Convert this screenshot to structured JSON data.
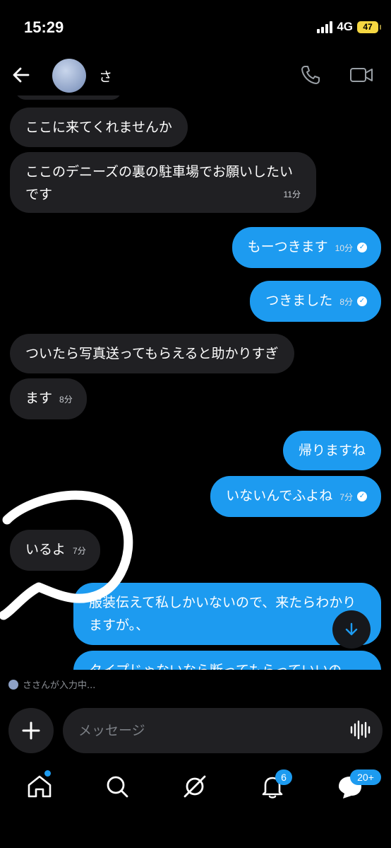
{
  "status": {
    "time": "15:29",
    "network": "4G",
    "battery": "47"
  },
  "header": {
    "contact_name": "さ"
  },
  "messages": [
    {
      "dir": "in",
      "text": "ここに来てくれませんか",
      "time": ""
    },
    {
      "dir": "in",
      "text": "ここのデニーズの裏の駐車場でお願いしたいです",
      "time": "11分"
    },
    {
      "dir": "out",
      "text": "もーつきます",
      "time": "10分"
    },
    {
      "dir": "out",
      "text": "つきました",
      "time": "8分"
    },
    {
      "dir": "in",
      "text": "ついたら写真送ってもらえると助かりすぎ",
      "time": ""
    },
    {
      "dir": "in",
      "text": "ます",
      "time": "8分"
    },
    {
      "dir": "out",
      "text": "帰りますね",
      "time": ""
    },
    {
      "dir": "out",
      "text": "いないんでふよね",
      "time": "7分"
    },
    {
      "dir": "in",
      "text": "いるよ",
      "time": "7分"
    },
    {
      "dir": "out",
      "text": "服装伝えて私しかいないので、来たらわかりますが。、",
      "time": ""
    },
    {
      "dir": "out",
      "text": "タイプじゃないなら断ってもらっていいの",
      "time": ""
    }
  ],
  "typing_indicator": "ささんが入力中...",
  "composer": {
    "placeholder": "メッセージ"
  },
  "tabs": {
    "notifications_badge": "6",
    "messages_badge": "20+"
  },
  "colors": {
    "accent": "#1d9bf0",
    "bubble_in": "#202023",
    "background": "#000000"
  }
}
